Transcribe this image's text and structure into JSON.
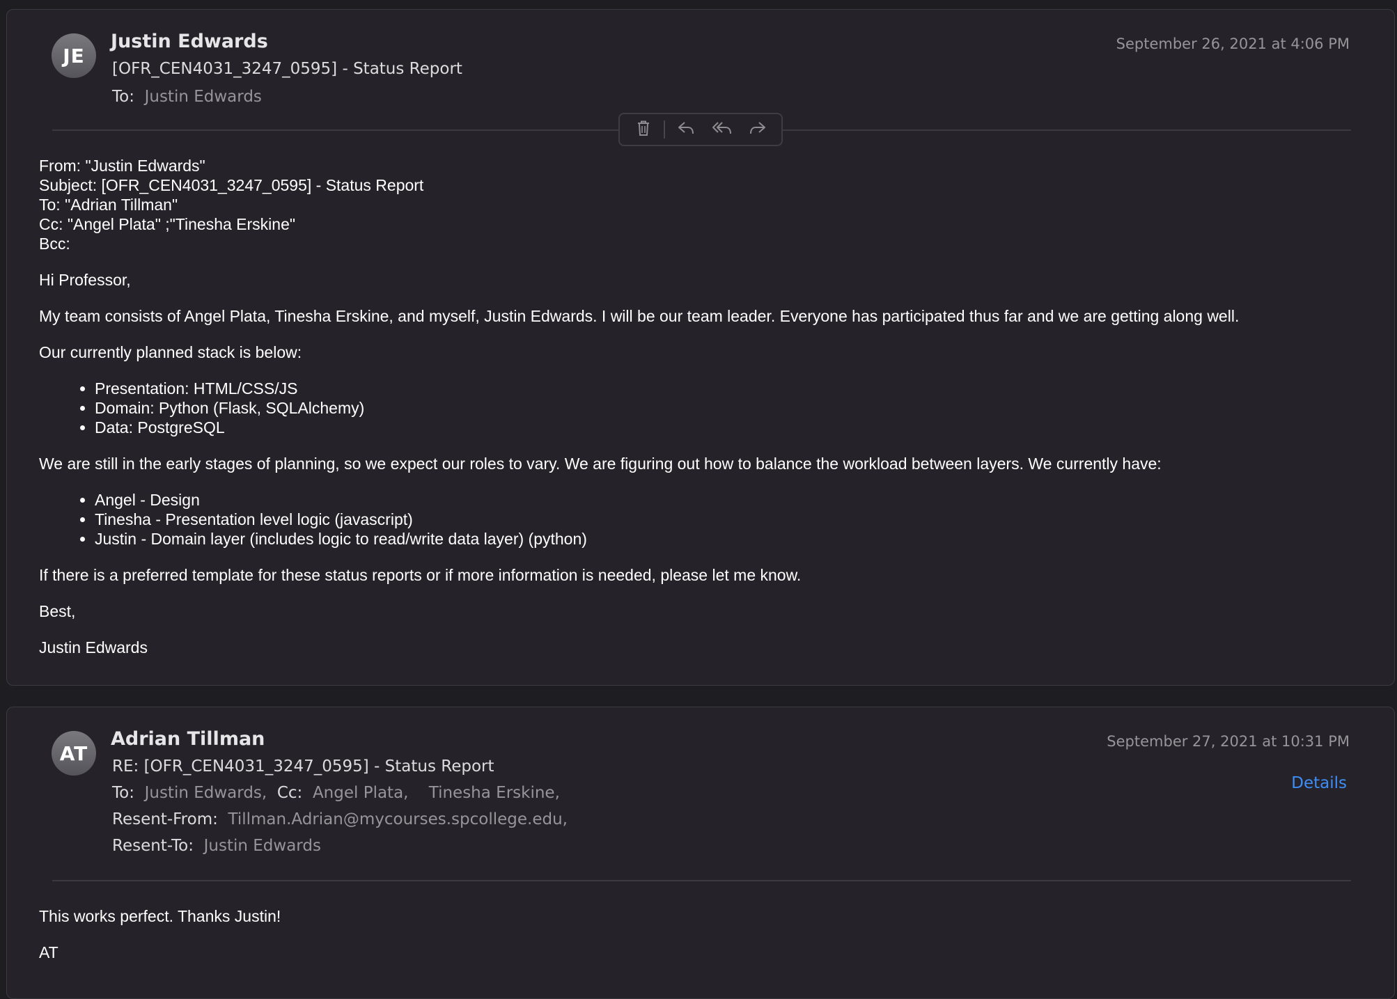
{
  "messages": [
    {
      "initials": "JE",
      "sender": "Justin Edwards",
      "subject": "[OFR_CEN4031_3247_0595] - Status Report",
      "date": "September 26, 2021 at 4:06 PM",
      "to_label": "To:",
      "to": "Justin Edwards",
      "body": {
        "header_lines": [
          "From: \"Justin Edwards\"",
          "Subject: [OFR_CEN4031_3247_0595] - Status Report",
          "To: \"Adrian Tillman\"",
          "Cc: \"Angel Plata\" ;\"Tinesha Erskine\"",
          "Bcc:"
        ],
        "greeting": "Hi Professor,",
        "para1": "My team consists of Angel Plata, Tinesha Erskine, and myself, Justin Edwards. I will be our team leader. Everyone has participated thus far and we are getting along well.",
        "para2": "Our currently planned stack is below:",
        "stack": [
          "Presentation: HTML/CSS/JS",
          "Domain: Python (Flask, SQLAlchemy)",
          "Data: PostgreSQL"
        ],
        "para3": "We are still in the early stages of planning, so we expect our roles to vary. We are figuring out how to balance the workload between layers. We currently have:",
        "roles": [
          "Angel - Design",
          "Tinesha - Presentation level logic (javascript)",
          "Justin - Domain layer (includes logic to read/write data layer) (python)"
        ],
        "para4": "If there is a preferred template for these status reports or if more information is needed, please let me know.",
        "closing": "Best,",
        "signature": "Justin Edwards"
      }
    },
    {
      "initials": "AT",
      "sender": "Adrian Tillman",
      "subject": "RE: [OFR_CEN4031_3247_0595] - Status Report",
      "date": "September 27, 2021 at 10:31 PM",
      "details": "Details",
      "to_label": "To:",
      "to": "Justin Edwards,",
      "cc_label": "Cc:",
      "cc1": "Angel Plata,",
      "cc2": "Tinesha Erskine,",
      "resent_from_label": "Resent-From:",
      "resent_from": "Tillman.Adrian@mycourses.spcollege.edu,",
      "resent_to_label": "Resent-To:",
      "resent_to": "Justin Edwards",
      "body": {
        "line1": "This works perfect. Thanks Justin!",
        "line2": "AT"
      }
    }
  ],
  "toolbar": {
    "icons": [
      "trash-icon",
      "reply-icon",
      "reply-all-icon",
      "forward-icon"
    ]
  },
  "colors": {
    "background": "#1e1d21",
    "card": "#252329",
    "muted_text": "#96959a",
    "link": "#3d8ef7"
  }
}
